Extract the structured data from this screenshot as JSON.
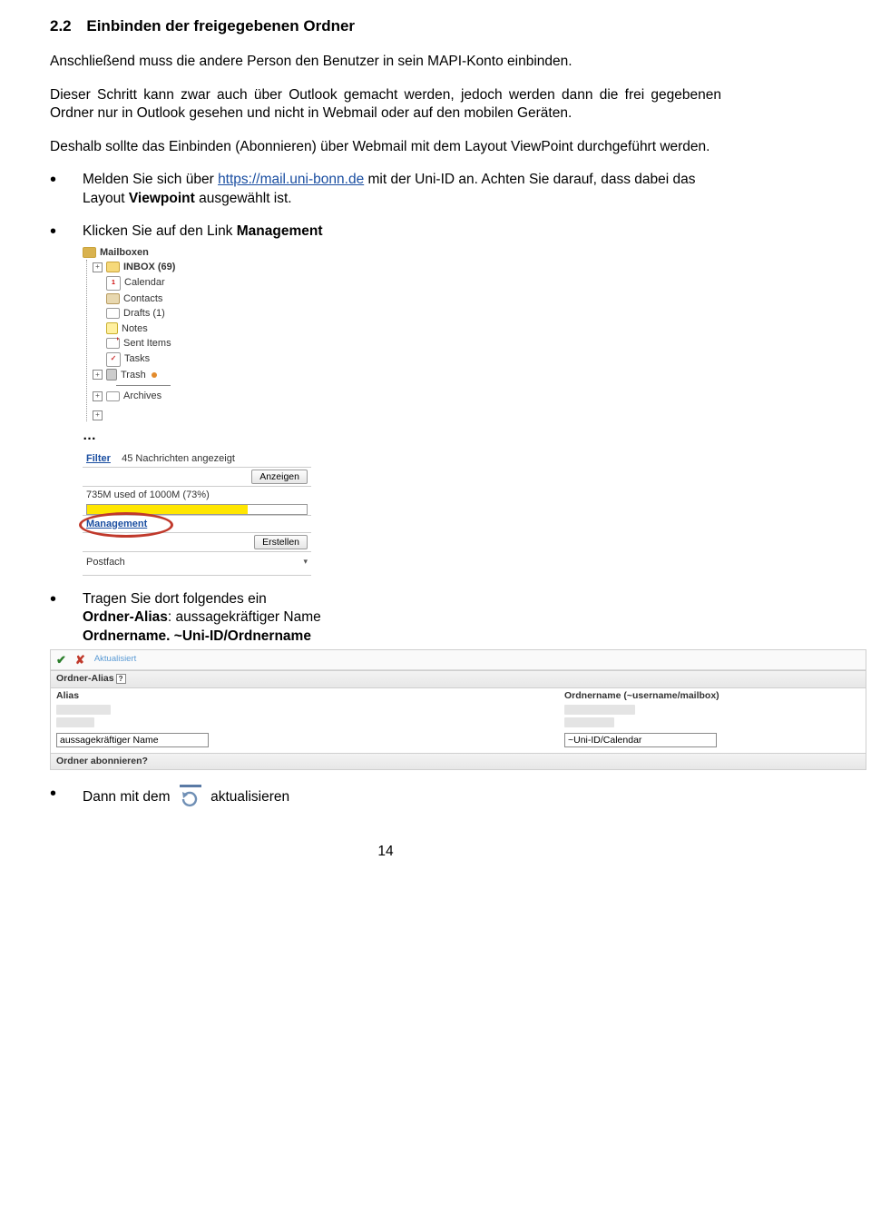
{
  "heading": {
    "number": "2.2",
    "title": "Einbinden der freigegebenen Ordner"
  },
  "para1": "Anschließend muss die andere Person den Benutzer in sein MAPI-Konto einbinden.",
  "para2": "Dieser Schritt kann zwar auch über Outlook gemacht werden, jedoch werden dann die frei gegebenen Ordner nur in Outlook gesehen und nicht in Webmail oder auf den mobilen Geräten.",
  "para3": "Deshalb sollte das Einbinden (Abonnieren) über Webmail mit dem Layout ViewPoint durchgeführt werden.",
  "bullet1": {
    "pre": "Melden Sie sich über ",
    "link_text": "https://mail.uni-bonn.de",
    "mid": " mit der Uni-ID an. Achten Sie darauf, dass dabei das Layout ",
    "bold": "Viewpoint",
    "post": " ausgewählt ist."
  },
  "bullet2": {
    "pre": "Klicken Sie auf den Link ",
    "bold": "Management"
  },
  "tree": {
    "root": "Mailboxen",
    "items": [
      {
        "label": "INBOX (69)"
      },
      {
        "label": "Calendar",
        "cal": "1"
      },
      {
        "label": "Contacts"
      },
      {
        "label": "Drafts (1)"
      },
      {
        "label": "Notes"
      },
      {
        "label": "Sent Items"
      },
      {
        "label": "Tasks",
        "task": "✓"
      },
      {
        "label": "Trash"
      }
    ],
    "archives": "Archives"
  },
  "ellipsis": "…",
  "panel": {
    "filter": "Filter",
    "filter_msg": "45 Nachrichten angezeigt",
    "anzeigen": "Anzeigen",
    "quota": "735M used of 1000M  (73%)",
    "management": "Management",
    "erstellen": "Erstellen",
    "postfach": "Postfach"
  },
  "bullet3": {
    "line1": "Tragen Sie dort folgendes ein",
    "line2a": "Ordner-Alias",
    "line2b": ": aussagekräftiger Name",
    "line3": "Ordnername. ~Uni-ID/Ordnername"
  },
  "wide": {
    "aktualisiert": "Aktualisiert",
    "sec1": "Ordner-Alias",
    "aliasHdr": "Alias",
    "ordnernameHdr": "Ordnername (~username/mailbox)",
    "aliasInput": "aussagekräftiger Name",
    "ordInput": "~Uni-ID/Calendar",
    "sec2": "Ordner abonnieren"
  },
  "bullet4": {
    "pre": "Dann mit dem ",
    "post": " aktualisieren"
  },
  "page": "14"
}
